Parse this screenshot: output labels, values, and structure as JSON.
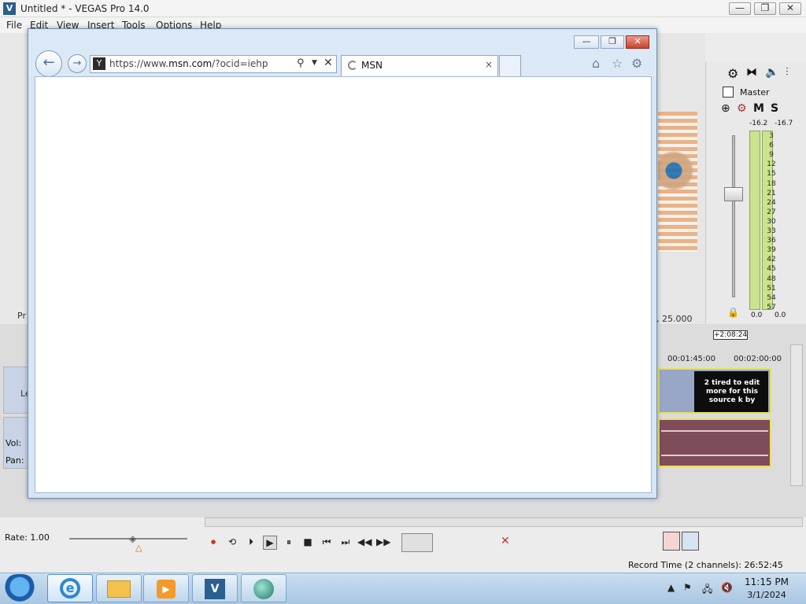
{
  "vegas": {
    "logo": "V",
    "title": "Untitled * - VEGAS Pro 14.0",
    "window_controls": {
      "minimize": "—",
      "maximize": "❐",
      "close": "✕"
    },
    "menu": [
      "File",
      "Edit",
      "View",
      "Insert",
      "Tools",
      "Options",
      "Help"
    ],
    "preview_info": ", 25.000",
    "master": {
      "label": "Master",
      "mute": "M",
      "solo": "S",
      "peak_left": "-16.2",
      "peak_right": "-16.7",
      "scale": [
        "3",
        "6",
        "9",
        "12",
        "15",
        "18",
        "21",
        "24",
        "27",
        "30",
        "33",
        "36",
        "39",
        "42",
        "45",
        "48",
        "51",
        "54",
        "57"
      ],
      "bottom_left": "0.0",
      "bottom_right": "0.0"
    },
    "timeline": {
      "marker": "+2:08:24",
      "ruler": [
        "00:01:45:00",
        "00:02:00:00"
      ],
      "video_event_text": "2 tired to edit more for this source k by",
      "track_label": "Le",
      "vol_label": "Vol:",
      "pan_label": "Pan:"
    },
    "left_panel_label": "Pr",
    "rate": "Rate: 1.00",
    "record_time": "Record Time (2 channels): 26:52:45",
    "transport": [
      "⏺",
      "⟲",
      "⏵",
      "▶",
      "⏸",
      "■",
      "⏮",
      "⏭",
      "◀◀",
      "▶▶"
    ]
  },
  "ie": {
    "window_controls": {
      "minimize": "—",
      "restore": "❐",
      "close": "✕"
    },
    "back": "←",
    "forward": "→",
    "favicon": "Y",
    "url_prefix": "https://www.",
    "url_host": "msn.com",
    "url_suffix": "/?ocid=iehp",
    "tab_title": "MSN",
    "tab_close": "×",
    "tools": {
      "home": "⌂",
      "favorites": "☆",
      "settings": "⚙"
    }
  },
  "taskbar": {
    "clock_time": "11:15 PM",
    "clock_date": "3/1/2024"
  }
}
